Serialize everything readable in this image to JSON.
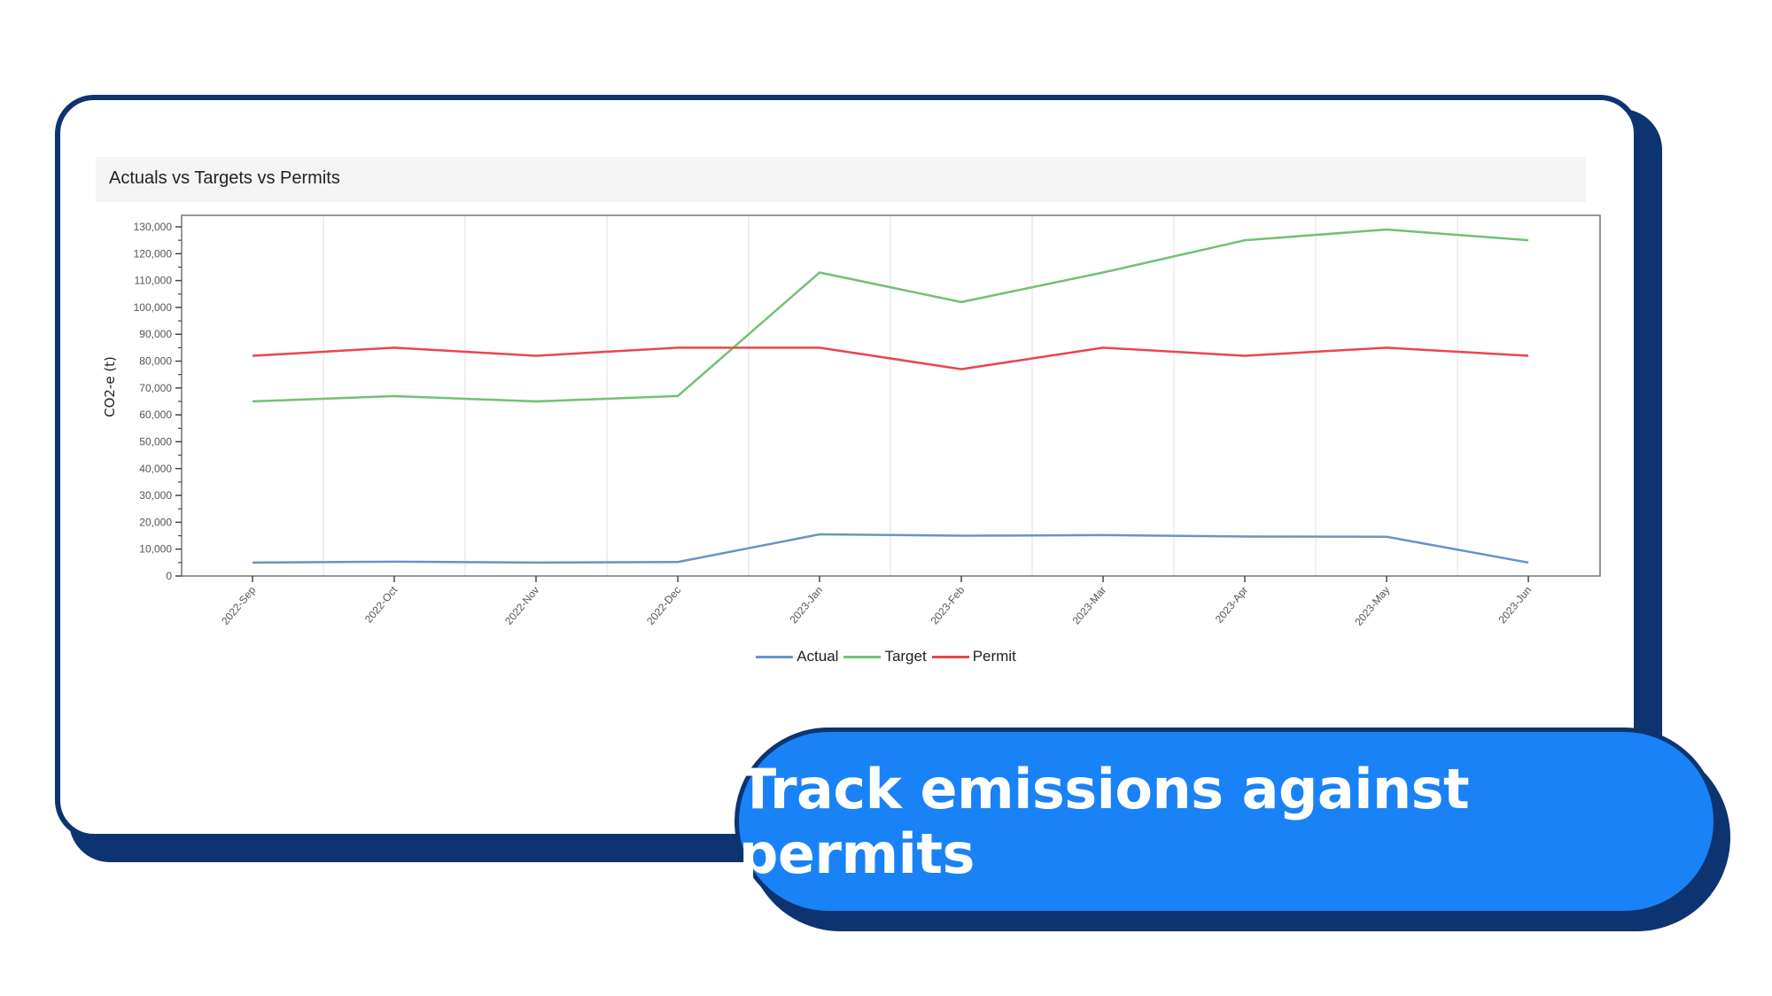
{
  "banner": {
    "text": "Track emissions against permits"
  },
  "colors": {
    "navy": "#0d3470",
    "accent": "#1a82f7"
  },
  "chart_data": {
    "type": "line",
    "title": "Actuals vs Targets vs Permits",
    "xlabel": "",
    "ylabel": "CO2-e (t)",
    "ylim": [
      0,
      130000
    ],
    "yticks": [
      0,
      10000,
      20000,
      30000,
      40000,
      50000,
      60000,
      70000,
      80000,
      90000,
      100000,
      110000,
      120000,
      130000
    ],
    "ytick_labels": [
      "0",
      "10,000",
      "20,000",
      "30,000",
      "40,000",
      "50,000",
      "60,000",
      "70,000",
      "80,000",
      "90,000",
      "100,000",
      "110,000",
      "120,000",
      "130,000"
    ],
    "categories": [
      "2022-Sep",
      "2022-Oct",
      "2022-Nov",
      "2022-Dec",
      "2023-Jan",
      "2023-Feb",
      "2023-Mar",
      "2023-Apr",
      "2023-May",
      "2023-Jun"
    ],
    "legend_position": "bottom-center",
    "grid": "vertical",
    "series": [
      {
        "name": "Actual",
        "color": "#6b93c8",
        "values": [
          5000,
          5300,
          5000,
          5200,
          15500,
          15000,
          15200,
          14700,
          14600,
          5000
        ]
      },
      {
        "name": "Target",
        "color": "#72c172",
        "values": [
          65000,
          67000,
          65000,
          67000,
          113000,
          102000,
          113000,
          125000,
          129000,
          125000
        ]
      },
      {
        "name": "Permit",
        "color": "#e8474c",
        "values": [
          82000,
          85000,
          82000,
          85000,
          85000,
          77000,
          85000,
          82000,
          85000,
          82000
        ]
      }
    ]
  }
}
